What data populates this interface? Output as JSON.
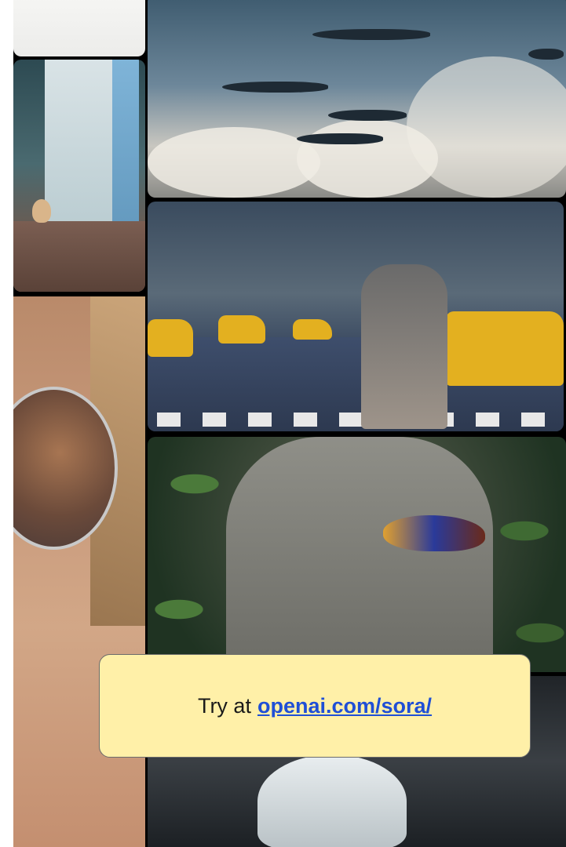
{
  "callout": {
    "prefix": "Try at",
    "link_text": "openai.com/sora/"
  },
  "gallery": {
    "tiles": [
      {
        "id": "top-left",
        "subject": "white surface with small animal"
      },
      {
        "id": "room",
        "subject": "toy room with bunny"
      },
      {
        "id": "face",
        "subject": "close-up face with sunglasses"
      },
      {
        "id": "whales",
        "subject": "whales and butterflies in sky"
      },
      {
        "id": "city",
        "subject": "city street with taxis"
      },
      {
        "id": "buddha",
        "subject": "stone buddha with bird"
      },
      {
        "id": "bottom",
        "subject": "shell on dark driftwood"
      }
    ]
  },
  "colors": {
    "callout_bg": "#fff0a8",
    "link": "#1f4fd6",
    "background": "#000000"
  }
}
